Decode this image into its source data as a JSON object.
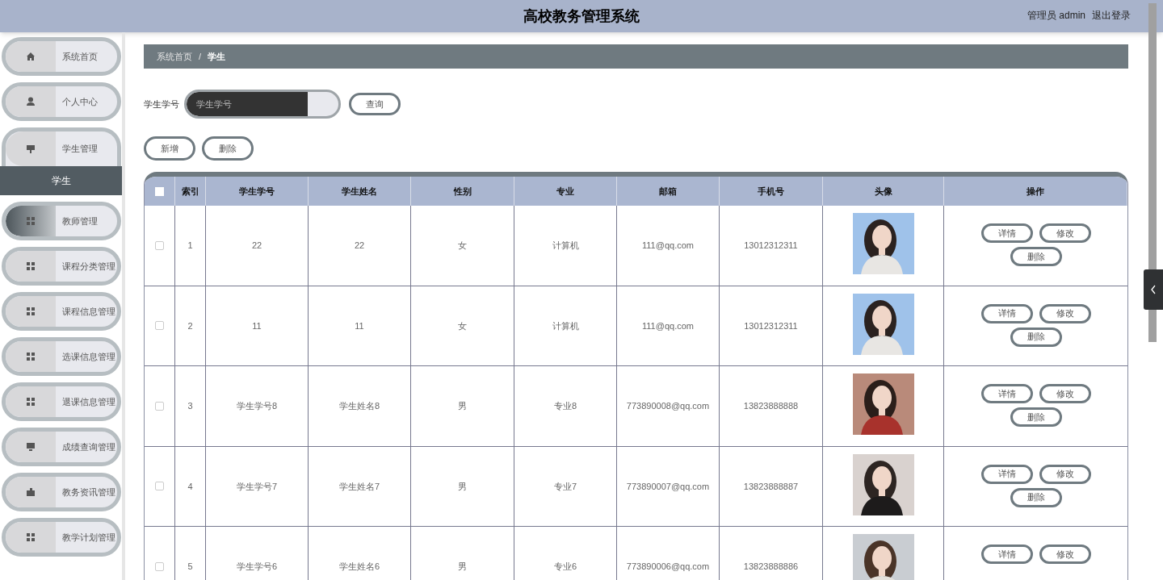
{
  "header": {
    "title": "高校教务管理系统",
    "user": "管理员 admin",
    "logout": "退出登录"
  },
  "sidebar": {
    "items": [
      {
        "label": "系统首页",
        "selected": false,
        "expanded": false
      },
      {
        "label": "个人中心",
        "selected": false,
        "expanded": false
      },
      {
        "label": "学生管理",
        "selected": false,
        "expanded": true,
        "children": [
          {
            "label": "学生",
            "selected": true
          }
        ]
      },
      {
        "label": "教师管理",
        "selected": true,
        "expanded": false
      },
      {
        "label": "课程分类管理",
        "selected": false,
        "expanded": false
      },
      {
        "label": "课程信息管理",
        "selected": false,
        "expanded": false
      },
      {
        "label": "选课信息管理",
        "selected": false,
        "expanded": false
      },
      {
        "label": "退课信息管理",
        "selected": false,
        "expanded": false
      },
      {
        "label": "成绩查询管理",
        "selected": false,
        "expanded": false
      },
      {
        "label": "教务资讯管理",
        "selected": false,
        "expanded": false
      },
      {
        "label": "教学计划管理",
        "selected": false,
        "expanded": false
      }
    ]
  },
  "breadcrumb": [
    "系统首页",
    "/",
    "学生"
  ],
  "search": {
    "label": "学生学号",
    "placeholder": "学生学号",
    "button": "查询"
  },
  "actions": [
    "新增",
    "删除"
  ],
  "table": {
    "select_all": {
      "checked": false
    },
    "columns": [
      "索引",
      "学生学号",
      "学生姓名",
      "性别",
      "专业",
      "邮箱",
      "手机号",
      "头像",
      "操作"
    ],
    "rows": [
      {
        "checked": false,
        "cells": [
          "1",
          "22",
          "22",
          "女",
          "计算机",
          "111@qq.com",
          "13012312311"
        ],
        "avatar": {
          "kind": "picture"
        },
        "buttons": [
          "详情",
          "修改",
          "删除"
        ]
      },
      {
        "checked": false,
        "cells": [
          "2",
          "11",
          "11",
          "女",
          "计算机",
          "111@qq.com",
          "13012312311"
        ],
        "avatar": {
          "kind": "picture"
        },
        "buttons": [
          "详情",
          "修改",
          "删除"
        ]
      },
      {
        "checked": false,
        "cells": [
          "3",
          "学生学号8",
          "学生姓名8",
          "男",
          "专业8",
          "773890008@qq.com",
          "13823888888"
        ],
        "avatar": {
          "kind": "picture"
        },
        "buttons": [
          "详情",
          "修改",
          "删除"
        ]
      },
      {
        "checked": false,
        "cells": [
          "4",
          "学生学号7",
          "学生姓名7",
          "男",
          "专业7",
          "773890007@qq.com",
          "13823888887"
        ],
        "avatar": {
          "kind": "picture"
        },
        "buttons": [
          "详情",
          "修改",
          "删除"
        ]
      },
      {
        "checked": false,
        "cells": [
          "5",
          "学生学号6",
          "学生姓名6",
          "男",
          "专业6",
          "773890006@qq.com",
          "13823888886"
        ],
        "avatar": {
          "kind": "picture"
        },
        "buttons": [
          "详情",
          "修改"
        ]
      }
    ]
  }
}
